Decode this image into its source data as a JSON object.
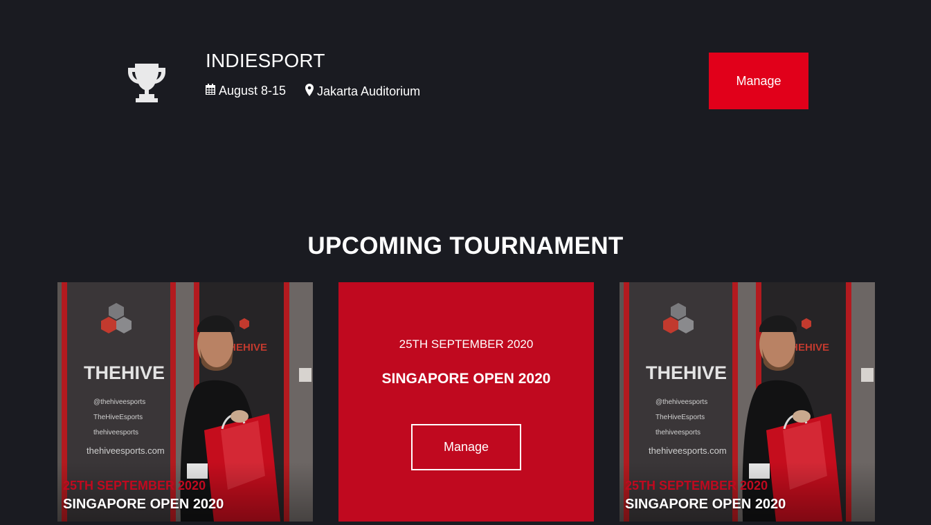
{
  "event": {
    "title": "INDIESPORT",
    "date": "August 8-15",
    "location": "Jakarta Auditorium",
    "manage_label": "Manage",
    "icons": {
      "trophy": "trophy-icon",
      "date": "calendar-icon",
      "location": "map-pin-icon"
    }
  },
  "section": {
    "title": "UPCOMING TOURNAMENT"
  },
  "cards": [
    {
      "date": "25TH SEPTEMBER 2020",
      "name": "SINGAPORE OPEN 2020",
      "banner_brand": "THEHIVE",
      "banner_brand_small": "THEHIVE",
      "banner_social": [
        "@thehiveesports",
        "TheHiveEsports",
        "thehiveesports"
      ],
      "banner_site": "thehiveesports.com"
    },
    {
      "date": "25TH SEPTEMBER 2020",
      "name": "SINGAPORE OPEN 2020",
      "manage_label": "Manage"
    },
    {
      "date": "25TH SEPTEMBER 2020",
      "name": "SINGAPORE OPEN 2020",
      "banner_brand": "THEHIVE",
      "banner_brand_small": "THEHIVE",
      "banner_social": [
        "@thehiveesports",
        "TheHiveEsports",
        "thehiveesports"
      ],
      "banner_site": "thehiveesports.com"
    }
  ],
  "colors": {
    "background": "#1a1b21",
    "accent": "#e1001a",
    "card_red": "#c0091f",
    "text": "#ffffff"
  }
}
